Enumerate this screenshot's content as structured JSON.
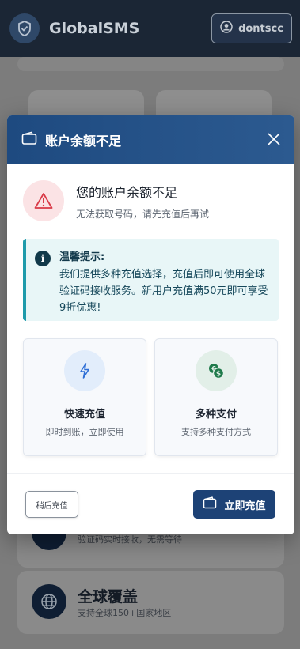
{
  "header": {
    "brand": "GlobalSMS",
    "user": "dontscc"
  },
  "background": {
    "feature_partial_sub": "验证码实时接收，无需等待",
    "feature_global_title": "全球覆盖",
    "feature_global_sub": "支持全球150+国家地区"
  },
  "modal": {
    "title": "账户余额不足",
    "alert_title": "您的账户余额不足",
    "alert_subtitle": "无法获取号码，请先充值后再试",
    "tip_title": "温馨提示:",
    "tip_body": "我们提供多种充值选择，充值后即可使用全球验证码接收服务。新用户充值满50元即可享受9折优惠!",
    "features": [
      {
        "title": "快速充值",
        "subtitle": "即时到账，立即使用",
        "icon": "lightning-icon"
      },
      {
        "title": "多种支付",
        "subtitle": "支持多种支付方式",
        "icon": "coins-icon"
      }
    ],
    "later_label": "稍后充值",
    "recharge_label": "立即充值"
  },
  "colors": {
    "header_bg": "#1b2635",
    "modal_header": "#1e4a80",
    "primary_button": "#1d4276",
    "alert_red": "#d93a47",
    "tip_accent": "#1f9bab"
  }
}
